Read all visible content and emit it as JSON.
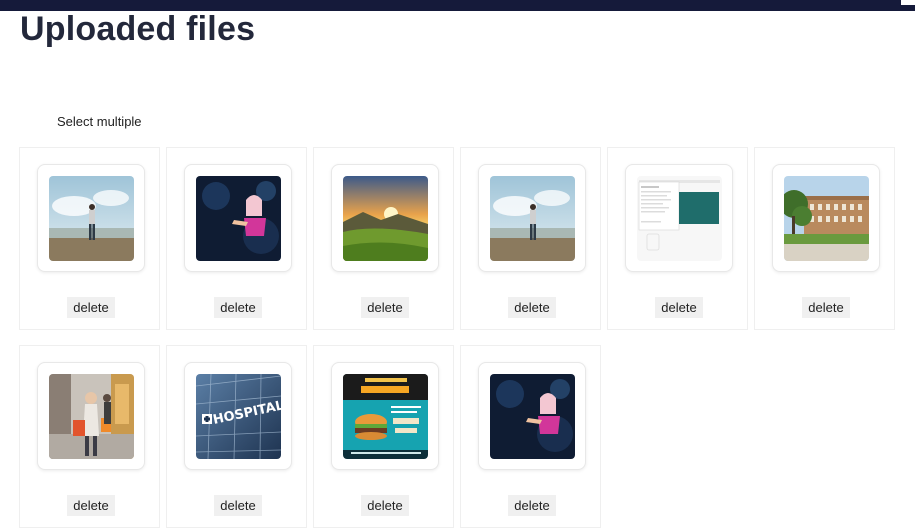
{
  "page": {
    "title": "Uploaded files",
    "select_multiple": "Select multiple"
  },
  "files": [
    {
      "image": "man-on-cliff-image",
      "delete_label": "delete"
    },
    {
      "image": "woman-dark-blue-image",
      "delete_label": "delete"
    },
    {
      "image": "sunset-landscape-image",
      "delete_label": "delete"
    },
    {
      "image": "man-on-cliff-image",
      "delete_label": "delete"
    },
    {
      "image": "screenshot-document-image",
      "delete_label": "delete"
    },
    {
      "image": "school-building-image",
      "delete_label": "delete"
    },
    {
      "image": "shopping-woman-image",
      "delete_label": "delete"
    },
    {
      "image": "hospital-sign-image",
      "delete_label": "delete"
    },
    {
      "image": "burger-poster-image",
      "delete_label": "delete"
    },
    {
      "image": "woman-dark-blue-image",
      "delete_label": "delete"
    }
  ],
  "colors": {
    "header_bar": "#151a3a",
    "delete_bg": "#f0f0f0",
    "card_border": "#efefef"
  }
}
